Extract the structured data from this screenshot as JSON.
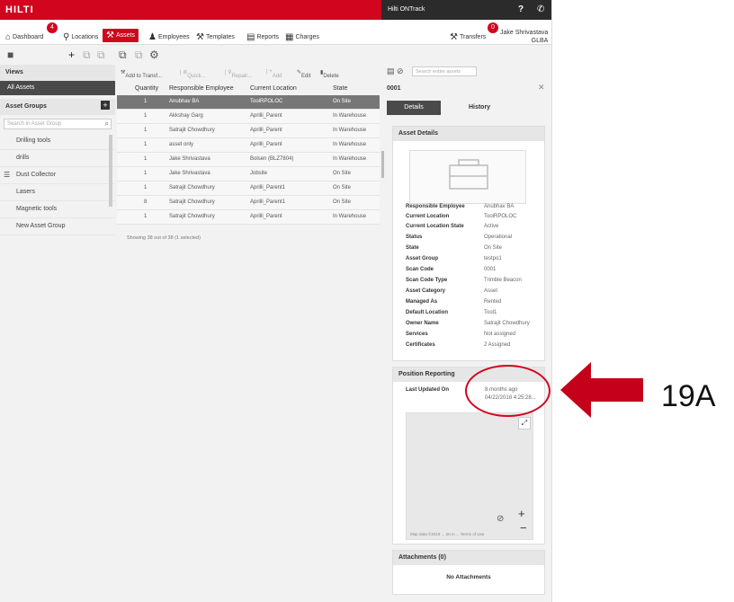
{
  "brand": {
    "logo": "HILTI",
    "accent": "#d2051e"
  },
  "topbar": {
    "account": "Hilti ONTrack",
    "help": "?",
    "phone_icon": "phone-icon"
  },
  "nav": {
    "items": [
      {
        "label": "Dashboard",
        "icon": "home-icon",
        "badge": "4"
      },
      {
        "label": "Locations",
        "icon": "location-icon"
      },
      {
        "label": "Assets",
        "icon": "tool-icon",
        "active": true
      },
      {
        "label": "Employees",
        "icon": "people-icon"
      },
      {
        "label": "Templates",
        "icon": "template-icon"
      },
      {
        "label": "Reports",
        "icon": "report-icon"
      },
      {
        "label": "Charges",
        "icon": "charges-icon"
      }
    ],
    "transfers": {
      "label": "Transfers",
      "badge": "0"
    },
    "user": {
      "name": "Jake Shrivastava",
      "sub": "GLBA"
    }
  },
  "sidebar": {
    "views_header": "Views",
    "all_assets": "All Assets",
    "groups_header": "Asset Groups",
    "search_placeholder": "Search in Asset Group",
    "groups": [
      "Drilling tools",
      "drills",
      "Dust Collector",
      "Lasers",
      "Magnetic tools",
      "New Asset Group"
    ]
  },
  "actions": {
    "add_transfer": "Add to Transf...",
    "quick": "Quick...",
    "repair": "Repair...",
    "add": "Add",
    "edit": "Edit",
    "delete": "Delete",
    "search_placeholder": "Search entire assets"
  },
  "table": {
    "columns": [
      "Quantity",
      "Responsible Employee",
      "Current Location",
      "State"
    ],
    "rows": [
      {
        "qty": "1",
        "employee": "Anubhav BA",
        "location": "ToolRPOLOC",
        "state": "On Site",
        "selected": true
      },
      {
        "qty": "1",
        "employee": "Akkshay Garg",
        "location": "Aprilli_Parent",
        "state": "In Warehouse"
      },
      {
        "qty": "1",
        "employee": "Satrajit Chowdhury",
        "location": "Aprilli_Parent",
        "state": "In Warehouse"
      },
      {
        "qty": "1",
        "employee": "asset only",
        "location": "Aprilli_Parent",
        "state": "In Warehouse"
      },
      {
        "qty": "1",
        "employee": "Jake Shrivastava",
        "location": "Bolsen (BLZ7804)",
        "state": "In Warehouse"
      },
      {
        "qty": "1",
        "employee": "Jake Shrivastava",
        "location": "Jobsite",
        "state": "On Site"
      },
      {
        "qty": "1",
        "employee": "Satrajit Chowdhury",
        "location": "Aprilli_Parent1",
        "state": "On Site"
      },
      {
        "qty": "8",
        "employee": "Satrajit Chowdhury",
        "location": "Aprilli_Parent1",
        "state": "On Site"
      },
      {
        "qty": "1",
        "employee": "Satrajit Chowdhury",
        "location": "Aprilli_Parent",
        "state": "In Warehouse"
      }
    ],
    "showing": "Showing 38 out of 38 (1 selected)"
  },
  "detail": {
    "title": "0001",
    "tabs": [
      "Details",
      "History"
    ],
    "asset_details_header": "Asset Details",
    "fields": [
      {
        "k": "Responsible Employee",
        "v": "Anubhav BA"
      },
      {
        "k": "Current Location",
        "v": "ToolRPOLOC"
      },
      {
        "k": "Current Location State",
        "v": "Active"
      },
      {
        "k": "Status",
        "v": "Operational"
      },
      {
        "k": "State",
        "v": "On Site"
      },
      {
        "k": "Asset Group",
        "v": "testpo1"
      },
      {
        "k": "Scan Code",
        "v": "0001"
      },
      {
        "k": "Scan Code Type",
        "v": "Trimble Beacon"
      },
      {
        "k": "Asset Category",
        "v": "Asset"
      },
      {
        "k": "Managed As",
        "v": "Rented"
      },
      {
        "k": "Default Location",
        "v": "Tool1"
      },
      {
        "k": "Owner Name",
        "v": "Satrajit Chowdhury"
      },
      {
        "k": "Services",
        "v": "Not assigned"
      },
      {
        "k": "Certificates",
        "v": "2 Assigned"
      }
    ],
    "position_header": "Position Reporting",
    "last_updated_label": "Last Updated On",
    "last_updated_value1": "8 months ago",
    "last_updated_value2": "04/22/2018 4:25:28...",
    "map_attribution": "Map data ©2019 ... 20 m ... Terms of Use",
    "attachments_header": "Attachments (0)",
    "no_attachments": "No Attachments"
  },
  "annotation": {
    "label": "19A",
    "color": "#d2051e"
  }
}
